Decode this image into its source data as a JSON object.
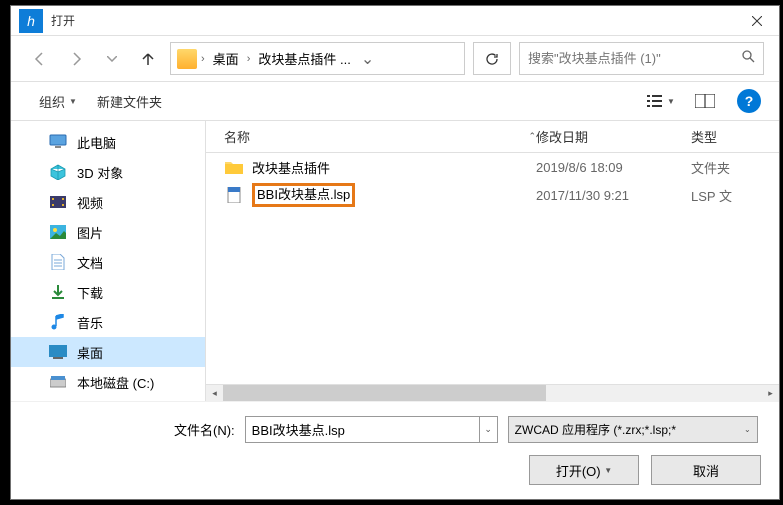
{
  "titlebar": {
    "title": "打开"
  },
  "breadcrumb": {
    "item1": "桌面",
    "item2": "改块基点插件 ..."
  },
  "search": {
    "placeholder": "搜索\"改块基点插件 (1)\""
  },
  "toolbar": {
    "organize": "组织",
    "new_folder": "新建文件夹"
  },
  "sidebar": {
    "items": [
      {
        "label": "此电脑"
      },
      {
        "label": "3D 对象"
      },
      {
        "label": "视频"
      },
      {
        "label": "图片"
      },
      {
        "label": "文档"
      },
      {
        "label": "下载"
      },
      {
        "label": "音乐"
      },
      {
        "label": "桌面"
      },
      {
        "label": "本地磁盘 (C:)"
      }
    ]
  },
  "columns": {
    "name": "名称",
    "date": "修改日期",
    "type": "类型"
  },
  "files": [
    {
      "name": "改块基点插件",
      "date": "2019/8/6 18:09",
      "type": "文件夹"
    },
    {
      "name": "BBI改块基点.lsp",
      "date": "2017/11/30 9:21",
      "type": "LSP 文"
    }
  ],
  "footer": {
    "filename_label": "文件名(N):",
    "filename_value": "BBI改块基点.lsp",
    "filter": "ZWCAD 应用程序 (*.zrx;*.lsp;*",
    "open": "打开(O)",
    "cancel": "取消"
  }
}
